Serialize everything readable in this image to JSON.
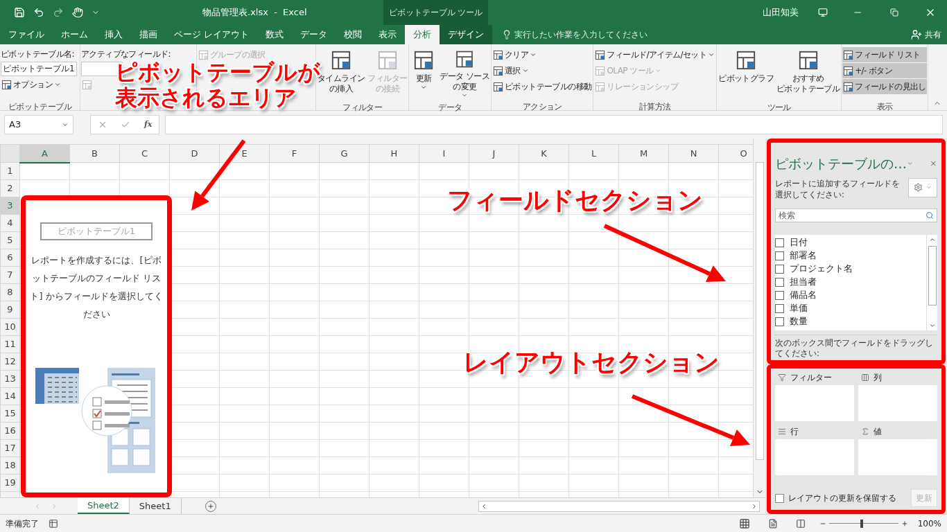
{
  "title_bar": {
    "title": "物品管理表.xlsx  -  Excel",
    "context_tab": "ピボットテーブル ツール",
    "user": "山田知美"
  },
  "ribbon_tabs": [
    {
      "label": "ファイル",
      "selected": false
    },
    {
      "label": "ホーム",
      "selected": false
    },
    {
      "label": "挿入",
      "selected": false
    },
    {
      "label": "描画",
      "selected": false
    },
    {
      "label": "ページ レイアウト",
      "selected": false
    },
    {
      "label": "数式",
      "selected": false
    },
    {
      "label": "データ",
      "selected": false
    },
    {
      "label": "校閲",
      "selected": false
    },
    {
      "label": "表示",
      "selected": false
    },
    {
      "label": "分析",
      "selected": true
    },
    {
      "label": "デザイン",
      "selected": false
    }
  ],
  "tell_me": {
    "placeholder": "実行したい作業を入力してください"
  },
  "share": "共有",
  "ribbon_groups": [
    {
      "label": "ピボットテーブル",
      "columns": [
        [
          {
            "kind": "label",
            "label": "ピボットテーブル名:"
          },
          {
            "kind": "field",
            "value": "ピボットテーブル1"
          },
          {
            "kind": "small",
            "label": "オプション",
            "dropdown": true,
            "disabled": false
          }
        ]
      ]
    },
    {
      "columns": [
        [
          {
            "kind": "label",
            "label": "アクティブなフィールド:"
          },
          {
            "kind": "field"
          },
          {
            "kind": "small",
            "dropdown": false,
            "disabled": true
          }
        ]
      ]
    },
    {
      "columns": [
        [
          {
            "kind": "small",
            "label": "グループの選択",
            "dropdown": false,
            "disabled": true
          }
        ]
      ]
    },
    {
      "label": "フィルター",
      "columns": [
        [
          {
            "kind": "large",
            "lines": [
              "タイムライン",
              "の挿入"
            ],
            "dropdown": false,
            "disabled": false
          }
        ],
        [
          {
            "kind": "large",
            "lines": [
              "フィルター",
              "の接続"
            ],
            "dropdown": false,
            "disabled": true
          }
        ]
      ]
    },
    {
      "label": "データ",
      "columns": [
        [
          {
            "kind": "large",
            "lines": [
              "更新"
            ],
            "dropdown": true,
            "disabled": false
          }
        ],
        [
          {
            "kind": "large",
            "lines": [
              "データ ソース",
              "の変更"
            ],
            "dropdown": true,
            "disabled": false
          }
        ]
      ]
    },
    {
      "label": "アクション",
      "columns": [
        [
          {
            "kind": "small",
            "label": "クリア",
            "dropdown": true,
            "disabled": false
          },
          {
            "kind": "small",
            "label": "選択",
            "dropdown": true,
            "disabled": false
          },
          {
            "kind": "small",
            "label": "ピボットテーブルの移動",
            "dropdown": false,
            "disabled": false
          }
        ]
      ]
    },
    {
      "label": "計算方法",
      "columns": [
        [
          {
            "kind": "small",
            "label": "フィールド/アイテム/セット",
            "dropdown": true,
            "disabled": false
          },
          {
            "kind": "small",
            "label": "OLAP ツール",
            "dropdown": true,
            "disabled": true
          },
          {
            "kind": "small",
            "label": "リレーションシップ",
            "dropdown": false,
            "disabled": true
          }
        ]
      ]
    },
    {
      "label": "ツール",
      "columns": [
        [
          {
            "kind": "large",
            "lines": [
              "ピボットグラフ"
            ],
            "dropdown": false,
            "disabled": false
          }
        ],
        [
          {
            "kind": "large",
            "lines": [
              "おすすめ",
              "ピボットテーブル"
            ],
            "dropdown": false,
            "disabled": false
          }
        ]
      ]
    },
    {
      "label": "表示",
      "columns": [
        [
          {
            "kind": "small",
            "label": "フィールド リスト",
            "dropdown": false,
            "disabled": false,
            "selected": true
          },
          {
            "kind": "small",
            "label": "+/- ボタン",
            "dropdown": false,
            "disabled": false,
            "selected": true
          },
          {
            "kind": "small",
            "label": "フィールドの見出し",
            "dropdown": false,
            "disabled": false,
            "selected": true
          }
        ]
      ]
    }
  ],
  "formula_bar": {
    "name_box": "A3",
    "function_label": "fx"
  },
  "grid": {
    "columns": [
      {
        "label": "A",
        "selected": true
      },
      {
        "label": "B",
        "selected": false
      },
      {
        "label": "C",
        "selected": false
      },
      {
        "label": "D",
        "selected": false
      },
      {
        "label": "E",
        "selected": false
      },
      {
        "label": "F",
        "selected": false
      },
      {
        "label": "G",
        "selected": false
      },
      {
        "label": "H",
        "selected": false
      },
      {
        "label": "I",
        "selected": false
      },
      {
        "label": "J",
        "selected": false
      },
      {
        "label": "K",
        "selected": false
      },
      {
        "label": "L",
        "selected": false
      },
      {
        "label": "M",
        "selected": false
      },
      {
        "label": "N",
        "selected": false
      },
      {
        "label": "O",
        "selected": false
      }
    ],
    "rows": [
      {
        "label": "1",
        "selected": false
      },
      {
        "label": "2",
        "selected": false
      },
      {
        "label": "3",
        "selected": true
      },
      {
        "label": "4",
        "selected": false
      },
      {
        "label": "5",
        "selected": false
      },
      {
        "label": "6",
        "selected": false
      },
      {
        "label": "7",
        "selected": false
      },
      {
        "label": "8",
        "selected": false
      },
      {
        "label": "9",
        "selected": false
      },
      {
        "label": "10",
        "selected": false
      },
      {
        "label": "11",
        "selected": false
      },
      {
        "label": "12",
        "selected": false
      },
      {
        "label": "13",
        "selected": false
      },
      {
        "label": "14",
        "selected": false
      },
      {
        "label": "15",
        "selected": false
      },
      {
        "label": "16",
        "selected": false
      },
      {
        "label": "17",
        "selected": false
      },
      {
        "label": "18",
        "selected": false
      },
      {
        "label": "19",
        "selected": false
      }
    ]
  },
  "pivot_placeholder": {
    "name": "ピボットテーブル1",
    "message": "レポートを作成するには、[ピボットテーブルのフィールド リスト] からフィールドを選択してください"
  },
  "sheets": [
    {
      "label": "Sheet2",
      "selected": true
    },
    {
      "label": "Sheet1",
      "selected": false
    }
  ],
  "field_pane": {
    "title": "ピボットテーブルの…",
    "instruction": "レポートに追加するフィールドを選択してください:",
    "search": {
      "placeholder": "検索"
    },
    "fields": [
      {
        "label": "日付",
        "checked": false
      },
      {
        "label": "部署名",
        "checked": false
      },
      {
        "label": "プロジェクト名",
        "checked": false
      },
      {
        "label": "担当者",
        "checked": false
      },
      {
        "label": "備品名",
        "checked": false
      },
      {
        "label": "単価",
        "checked": false
      },
      {
        "label": "数量",
        "checked": false
      }
    ],
    "drag_hint": "次のボックス間でフィールドをドラッグしてください:",
    "areas": [
      {
        "kind": "filter",
        "label": "フィルター"
      },
      {
        "kind": "columns",
        "label": "列"
      },
      {
        "kind": "rows",
        "label": "行"
      },
      {
        "kind": "values",
        "label": "値"
      }
    ],
    "defer_update": {
      "label": "レイアウトの更新を保留する",
      "checked": false
    },
    "update_button": {
      "label": "更新",
      "disabled": true
    }
  },
  "status_bar": {
    "status": "準備完了",
    "zoom": "100%",
    "zoom_slider": {
      "level": 0.47
    }
  },
  "annotations": [
    {
      "lines": [
        "ピボットテーブルが",
        "表示されるエリア"
      ]
    },
    {
      "lines": [
        "フィールドセクション"
      ]
    },
    {
      "lines": [
        "レイアウトセクション"
      ]
    }
  ]
}
